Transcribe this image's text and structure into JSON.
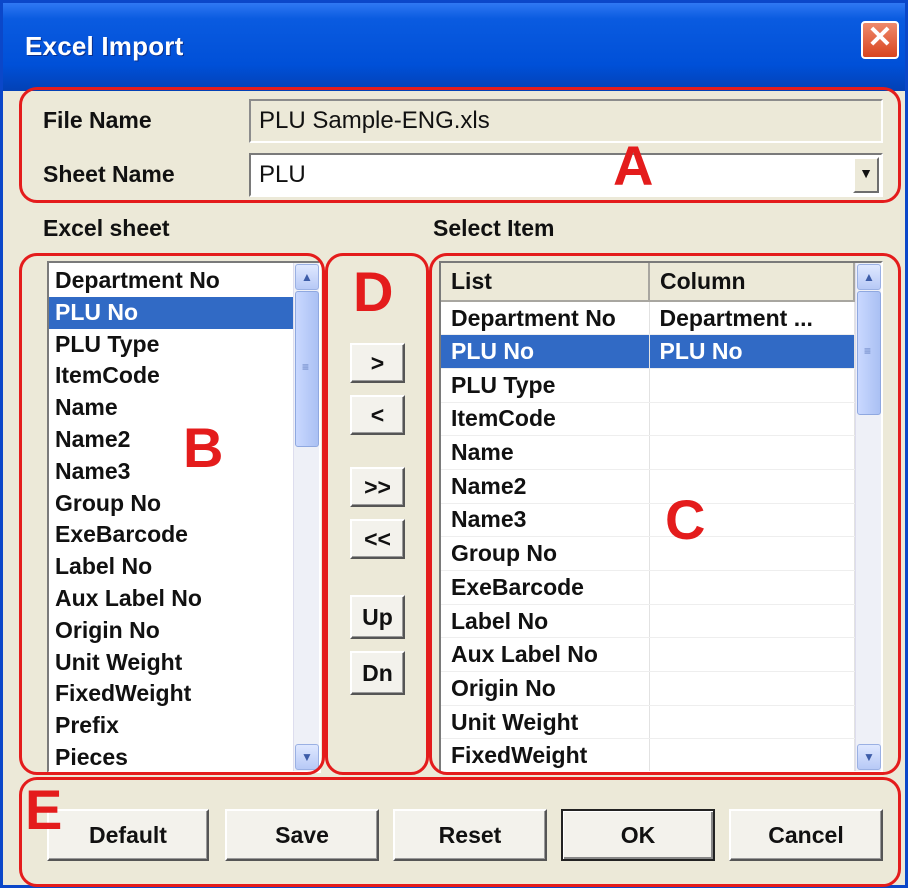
{
  "window": {
    "title": "Excel Import",
    "close_symbol": "✕"
  },
  "file_section": {
    "file_name_label": "File Name",
    "file_name_value": "PLU Sample-ENG.xls",
    "sheet_name_label": "Sheet Name",
    "sheet_name_value": "PLU",
    "dropdown_arrow": "▼"
  },
  "excel_sheet": {
    "label": "Excel sheet",
    "items": [
      "Department No",
      "PLU No",
      "PLU Type",
      "ItemCode",
      "Name",
      "Name2",
      "Name3",
      "Group No",
      "ExeBarcode",
      "Label No",
      "Aux Label No",
      "Origin No",
      "Unit Weight",
      "FixedWeight",
      "Prefix",
      "Pieces"
    ],
    "selected_index": 1
  },
  "move_buttons": {
    "add": ">",
    "remove": "<",
    "add_all": ">>",
    "remove_all": "<<",
    "up": "Up",
    "down": "Dn"
  },
  "select_item": {
    "label": "Select Item",
    "columns": [
      "List",
      "Column"
    ],
    "rows": [
      [
        "Department No",
        "Department ..."
      ],
      [
        "PLU No",
        "PLU No"
      ],
      [
        "PLU Type",
        ""
      ],
      [
        "ItemCode",
        ""
      ],
      [
        "Name",
        ""
      ],
      [
        "Name2",
        ""
      ],
      [
        "Name3",
        ""
      ],
      [
        "Group No",
        ""
      ],
      [
        "ExeBarcode",
        ""
      ],
      [
        "Label No",
        ""
      ],
      [
        "Aux Label No",
        ""
      ],
      [
        "Origin No",
        ""
      ],
      [
        "Unit Weight",
        ""
      ],
      [
        "FixedWeight",
        ""
      ]
    ],
    "selected_index": 1
  },
  "footer_buttons": {
    "default": "Default",
    "save": "Save",
    "reset": "Reset",
    "ok": "OK",
    "cancel": "Cancel"
  },
  "scroll_arrows": {
    "up": "▲",
    "down": "▼",
    "grip": "≡"
  },
  "annotations": {
    "a": "A",
    "b": "B",
    "c": "C",
    "d": "D",
    "e": "E",
    "color": "#e41c1c"
  },
  "colors": {
    "titlebar": "#0050d8",
    "selection": "#316ac5",
    "dialog_bg": "#ece9d8"
  }
}
